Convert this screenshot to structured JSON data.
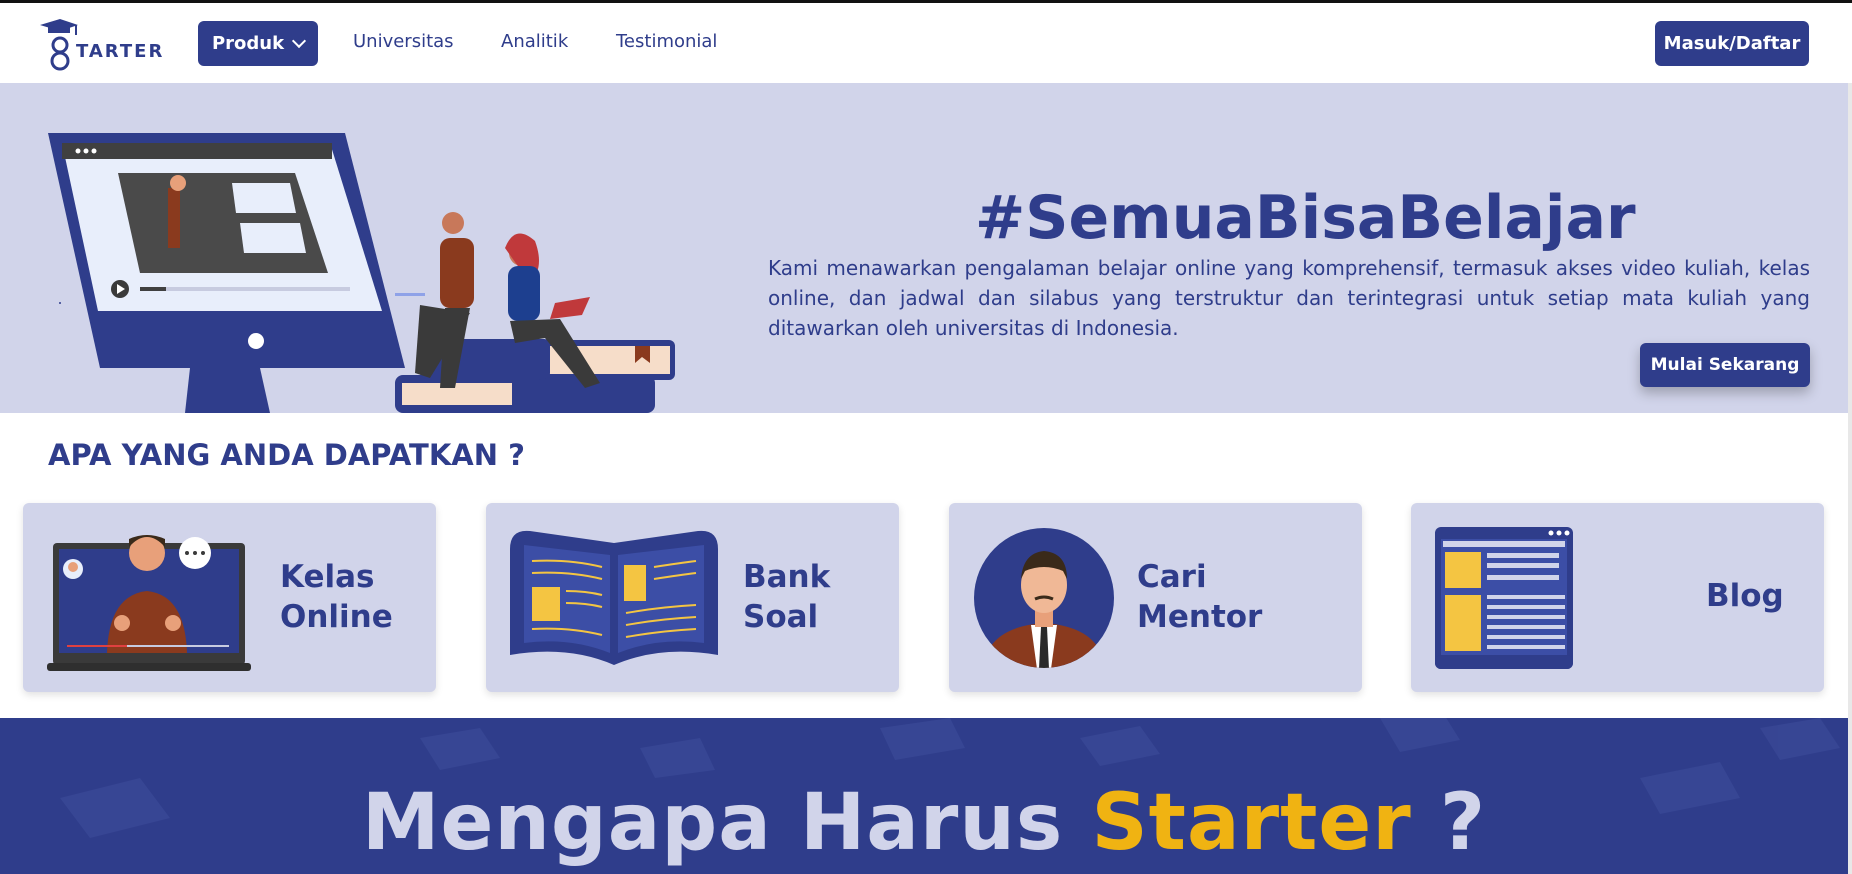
{
  "navbar": {
    "logo_text": "TARTER",
    "menu": {
      "produk": "Produk",
      "universitas": "Universitas",
      "analitik": "Analitik",
      "testimonial": "Testimonial"
    },
    "login_label": "Masuk/Daftar"
  },
  "hero": {
    "title": "#SemuaBisaBelajar",
    "description": "Kami menawarkan pengalaman belajar online yang komprehensif, termasuk akses video kuliah, kelas online, dan jadwal dan silabus yang terstruktur dan terintegrasi untuk setiap mata kuliah yang ditawarkan oleh universitas di Indonesia.",
    "cta_label": "Mulai Sekarang"
  },
  "benefits": {
    "title": "APA YANG ANDA DAPATKAN ?",
    "cards": [
      {
        "line1": "Kelas",
        "line2": "Online",
        "icon": "online-class-icon"
      },
      {
        "line1": "Bank",
        "line2": "Soal",
        "icon": "open-book-icon"
      },
      {
        "line1": "Cari",
        "line2": "Mentor",
        "icon": "mentor-avatar-icon"
      },
      {
        "line1": "Blog",
        "line2": "",
        "icon": "blog-page-icon"
      }
    ]
  },
  "why": {
    "prefix": "Mengapa Harus ",
    "accent": "Starter",
    "suffix": " ?"
  },
  "colors": {
    "primary": "#2f3d8b",
    "light": "#d1d4ea",
    "accent": "#f0b312"
  }
}
